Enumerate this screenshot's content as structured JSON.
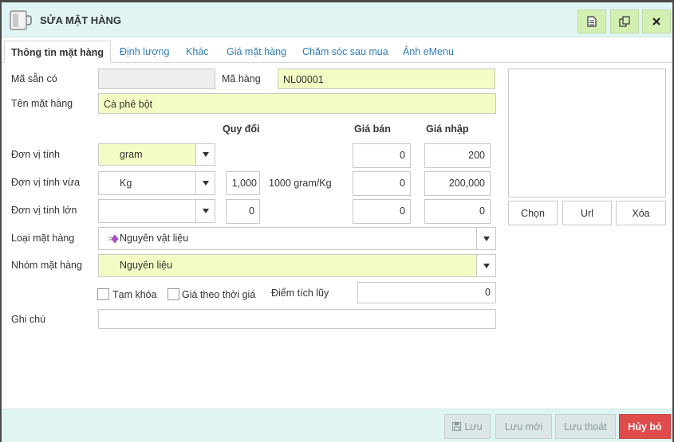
{
  "window": {
    "title": "SỬA MẶT HÀNG"
  },
  "toolbar": {
    "icons": [
      "document-icon",
      "copy-icon",
      "close-icon"
    ]
  },
  "tabs": [
    {
      "label": "Thông tin mặt hàng",
      "active": true
    },
    {
      "label": "Định lượng"
    },
    {
      "label": "Khác"
    },
    {
      "label": "Giá mặt hàng"
    },
    {
      "label": "Chăm sóc sau mua"
    },
    {
      "label": "Ảnh eMenu"
    }
  ],
  "form": {
    "ma_san_co": {
      "label": "Mã sẵn có",
      "value": ""
    },
    "ma_hang": {
      "label": "Mã hàng",
      "value": "NL00001"
    },
    "ten_mat_hang": {
      "label": "Tên mặt hàng",
      "value": "Cà phê bột"
    },
    "headers": {
      "quy_doi": "Quy đổi",
      "gia_ban": "Giá bán",
      "gia_nhap": "Giá nhập"
    },
    "units": [
      {
        "label": "Đơn vị tính",
        "unit": "gram",
        "conversion": "",
        "conversion_text": "",
        "gia_ban": "0",
        "gia_nhap": "200"
      },
      {
        "label": "Đơn vị tính vừa",
        "unit": "Kg",
        "conversion": "1,000",
        "conversion_text": "1000 gram/Kg",
        "gia_ban": "0",
        "gia_nhap": "200,000"
      },
      {
        "label": "Đơn vị tính lớn",
        "unit": "",
        "conversion": "0",
        "conversion_text": "",
        "gia_ban": "0",
        "gia_nhap": "0"
      }
    ],
    "loai_mat_hang": {
      "label": "Loại mặt hàng",
      "value": "Nguyên vật liệu"
    },
    "nhom_mat_hang": {
      "label": "Nhóm mặt hàng",
      "value": "Nguyên liệu"
    },
    "tam_khoa": {
      "label": "Tạm khóa",
      "checked": false
    },
    "gia_theo_thoi_gia": {
      "label": "Giá theo thời giá",
      "checked": false
    },
    "diem_tich_luy": {
      "label": "Điểm tích lũy",
      "value": "0"
    },
    "ghi_chu": {
      "label": "Ghi chú",
      "value": ""
    }
  },
  "image_buttons": {
    "chon": "Chọn",
    "url": "Url",
    "xoa": "Xóa"
  },
  "footer": {
    "luu": "Lưu",
    "luu_moi": "Lưu mới",
    "luu_thoat": "Lưu thoát",
    "huy_bo": "Hủy bỏ"
  },
  "colors": {
    "header_bg": "#e0f5f3",
    "toolbar_btn": "#d3f0b3",
    "required_field": "#f4fbc4",
    "cancel": "#e04b4b",
    "tab_link": "#2e7bb5"
  }
}
